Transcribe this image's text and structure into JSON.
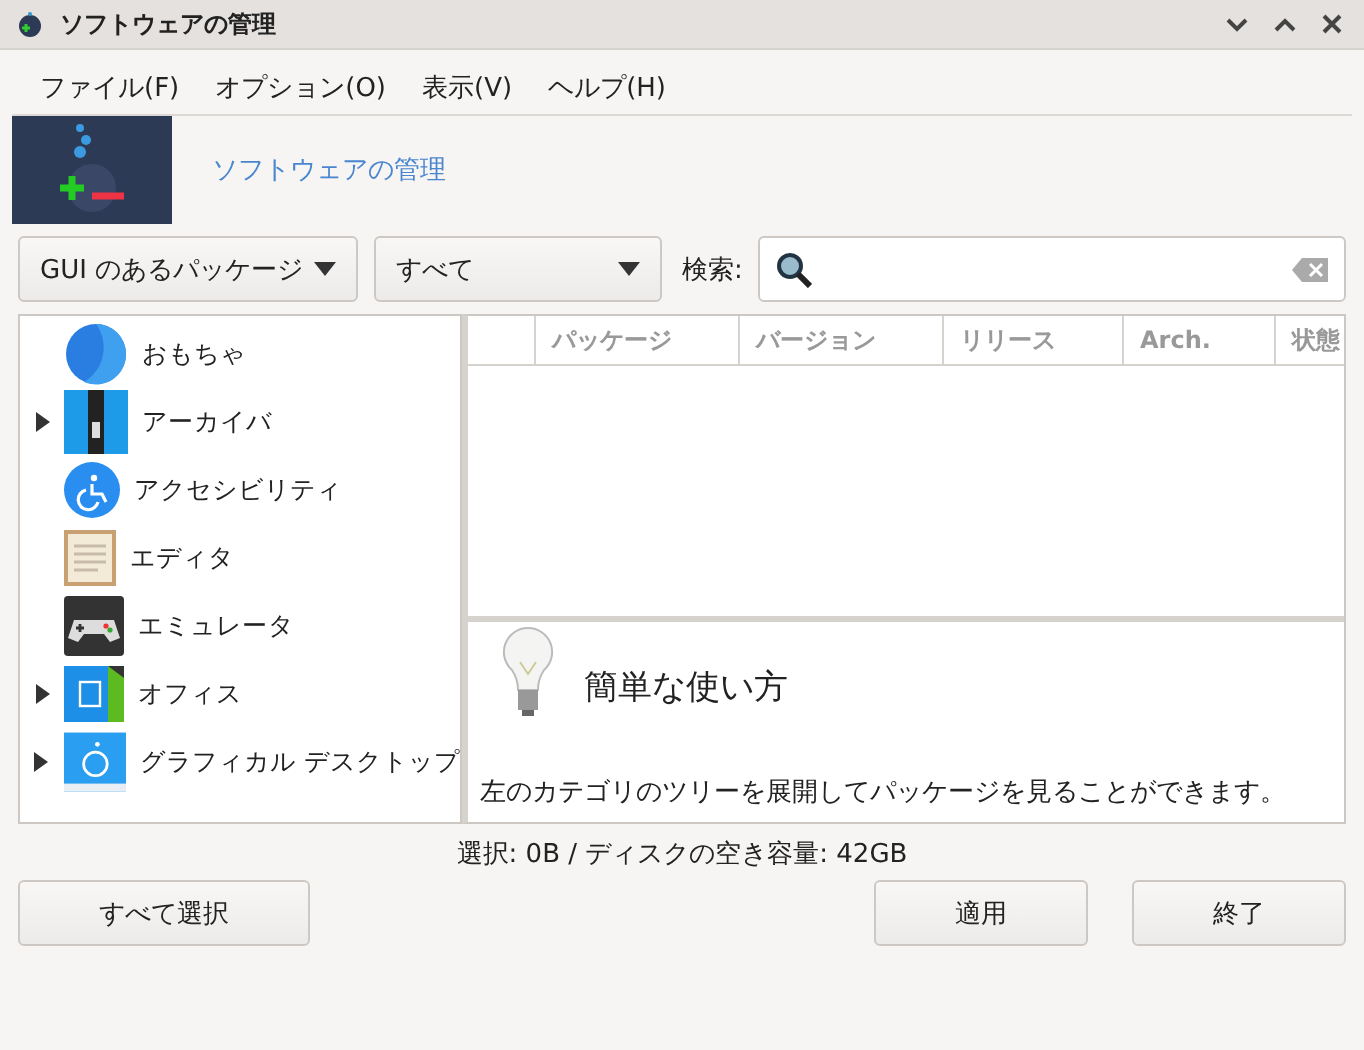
{
  "window": {
    "title": "ソフトウェアの管理"
  },
  "menu": [
    "ファイル(F)",
    "オプション(O)",
    "表示(V)",
    "ヘルプ(H)"
  ],
  "banner": {
    "title": "ソフトウェアの管理"
  },
  "filters": {
    "type": "GUI のあるパッケージ",
    "scope": "すべて",
    "search_label": "検索:"
  },
  "categories": [
    {
      "label": "おもちゃ",
      "expandable": false
    },
    {
      "label": "アーカイバ",
      "expandable": true
    },
    {
      "label": "アクセシビリティ",
      "expandable": false
    },
    {
      "label": "エディタ",
      "expandable": false
    },
    {
      "label": "エミュレータ",
      "expandable": false
    },
    {
      "label": "オフィス",
      "expandable": true
    },
    {
      "label": "グラフィカル デスクトップ",
      "expandable": true
    }
  ],
  "table": {
    "columns": [
      "パッケージ",
      "バージョン",
      "リリース",
      "Arch.",
      "状態"
    ]
  },
  "help": {
    "title": "簡単な使い方",
    "text": "左のカテゴリのツリーを展開してパッケージを見ることができます。"
  },
  "status_bar": "選択: 0B / ディスクの空き容量: 42GB",
  "buttons": {
    "select_all": "すべて選択",
    "apply": "適用",
    "quit": "終了"
  }
}
